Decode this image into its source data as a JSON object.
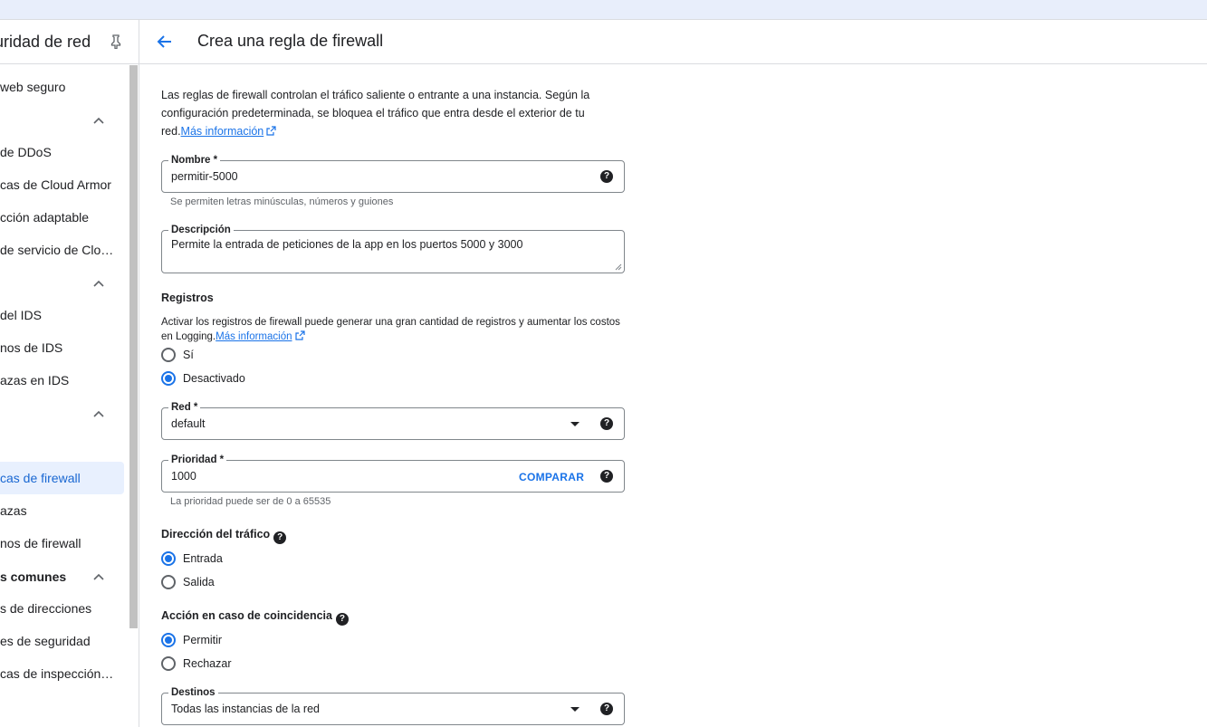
{
  "sidebar": {
    "title": "Seguridad de red",
    "items": [
      {
        "label": "Proxy web seguro"
      },
      {
        "label": "Protección de DDoS"
      },
      {
        "label": "Políticas de Cloud Armor"
      },
      {
        "label": "Protección adaptable"
      },
      {
        "label": "Políticas de servicio de Cloud Armor"
      },
      {
        "label": "Extremos del IDS"
      },
      {
        "label": "Extremos de IDS"
      },
      {
        "label": "Amenazas en IDS"
      },
      {
        "label": "Políticas de firewall"
      },
      {
        "label": "Amenazas"
      },
      {
        "label": "Extremos de firewall"
      },
      {
        "label": "Grupos de direcciones"
      },
      {
        "label": "Etiquetas de seguridad"
      },
      {
        "label": "Políticas de inspección TLS"
      }
    ],
    "visible_items": [
      "web seguro",
      "de DDoS",
      "cas de Cloud Armor",
      "cción adaptable",
      "de servicio de Clo…",
      "del IDS",
      "nos de IDS",
      "azas en IDS",
      "cas de firewall",
      "azas",
      "nos de firewall",
      "s de direcciones",
      "es de seguridad",
      "cas de inspección…"
    ],
    "section_common": "s comunes",
    "visible_title": "uridad de red"
  },
  "header": {
    "title": "Crea una regla de firewall"
  },
  "intro": {
    "text": "Las reglas de firewall controlan el tráfico saliente o entrante a una instancia. Según la configuración predeterminada, se bloquea el tráfico que entra desde el exterior de tu red.",
    "link": "Más información"
  },
  "form": {
    "name": {
      "label": "Nombre *",
      "value": "permitir-5000",
      "hint": "Se permiten letras minúsculas, números y guiones"
    },
    "description": {
      "label": "Descripción",
      "value": "Permite la entrada de peticiones  de la app en los puertos 5000 y 3000"
    },
    "logs": {
      "title": "Registros",
      "text": "Activar los registros de firewall puede generar una gran cantidad de registros y aumentar los costos en Logging.",
      "link": "Más información",
      "options": [
        "Sí",
        "Desactivado"
      ],
      "selected": "Desactivado"
    },
    "network": {
      "label": "Red *",
      "value": "default"
    },
    "priority": {
      "label": "Prioridad *",
      "value": "1000",
      "compare": "COMPARAR",
      "hint": "La prioridad puede ser de 0 a 65535"
    },
    "direction": {
      "title": "Dirección del tráfico",
      "options": [
        "Entrada",
        "Salida"
      ],
      "selected": "Entrada"
    },
    "action": {
      "title": "Acción en caso de coincidencia",
      "options": [
        "Permitir",
        "Rechazar"
      ],
      "selected": "Permitir"
    },
    "targets": {
      "label": "Destinos",
      "value": "Todas las instancias de la red"
    }
  },
  "colors": {
    "accent": "#1a73e8",
    "active_bg": "#e8f0fe",
    "border": "#80868b"
  }
}
